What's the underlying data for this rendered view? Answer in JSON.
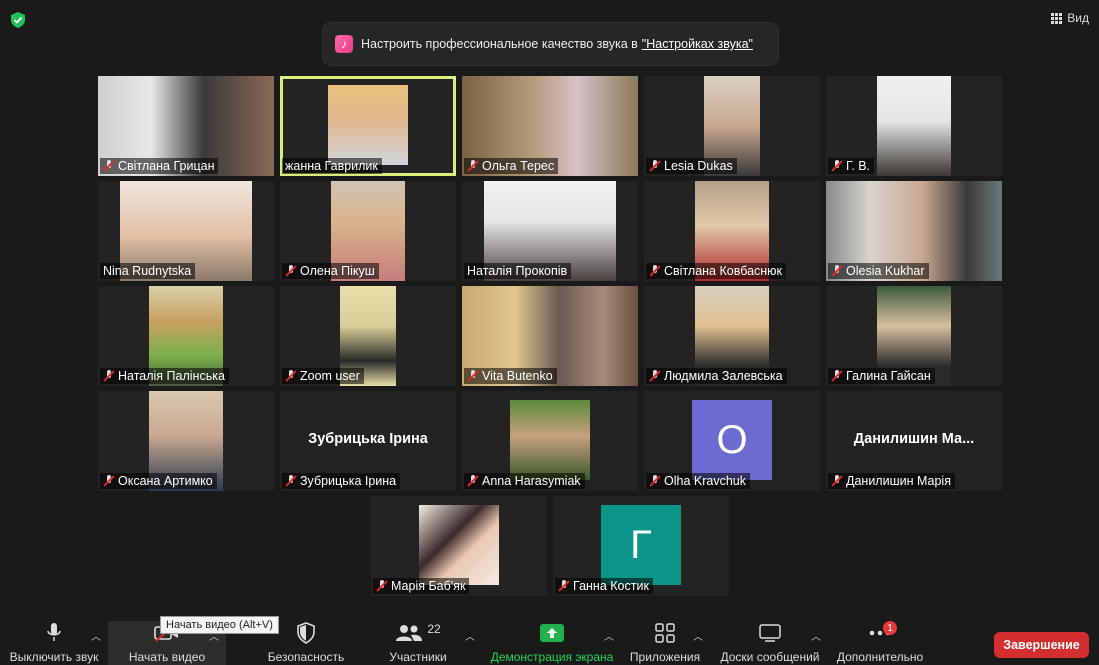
{
  "top": {
    "view_label": "Вид",
    "banner_text": "Настроить профессиональное качество звука в",
    "banner_link": "\"Настройках звука\""
  },
  "participants": [
    {
      "name": "Світлана Грицан"
    },
    {
      "name": "жанна Гаврилик"
    },
    {
      "name": "Ольга Терес"
    },
    {
      "name": "Lesia Dukas"
    },
    {
      "name": "Г. В."
    },
    {
      "name": "Nina Rudnytska"
    },
    {
      "name": "Олена Пікуш"
    },
    {
      "name": "Наталія Прокопів"
    },
    {
      "name": "Світлана Ковбаснюк"
    },
    {
      "name": "Olesia Kukhar"
    },
    {
      "name": "Наталія Палінська"
    },
    {
      "name": "Zoom user"
    },
    {
      "name": "Vita Butenko"
    },
    {
      "name": "Людмила Залевська"
    },
    {
      "name": "Галина Гайсан"
    },
    {
      "name": "Оксана Артимко"
    },
    {
      "name": "Зубрицька Ірина",
      "display": "Зубрицька Ірина"
    },
    {
      "name": "Anna Harasymiak"
    },
    {
      "name": "Olha Kravchuk",
      "initial": "O"
    },
    {
      "name": "Данилишин Марія",
      "display": "Данилишин Ма..."
    },
    {
      "name": "Марія Баб'як"
    },
    {
      "name": "Ганна Костик",
      "initial": "Г"
    }
  ],
  "toolbar": {
    "mute": "Выключить звук",
    "video": "Начать видео",
    "video_tooltip": "Начать видео (Alt+V)",
    "security": "Безопасность",
    "participants": "Участники",
    "participants_count": "22",
    "share": "Демонстрация экрана",
    "apps": "Приложения",
    "whiteboards": "Доски сообщений",
    "more": "Дополнительно",
    "more_badge": "1",
    "end": "Завершение"
  },
  "colors": {
    "active_speaker": "#d4f07a",
    "share_green": "#22b24c",
    "end_red": "#d32f2f",
    "avatar_purple": "#6b6bd1",
    "avatar_teal": "#0b9488"
  }
}
